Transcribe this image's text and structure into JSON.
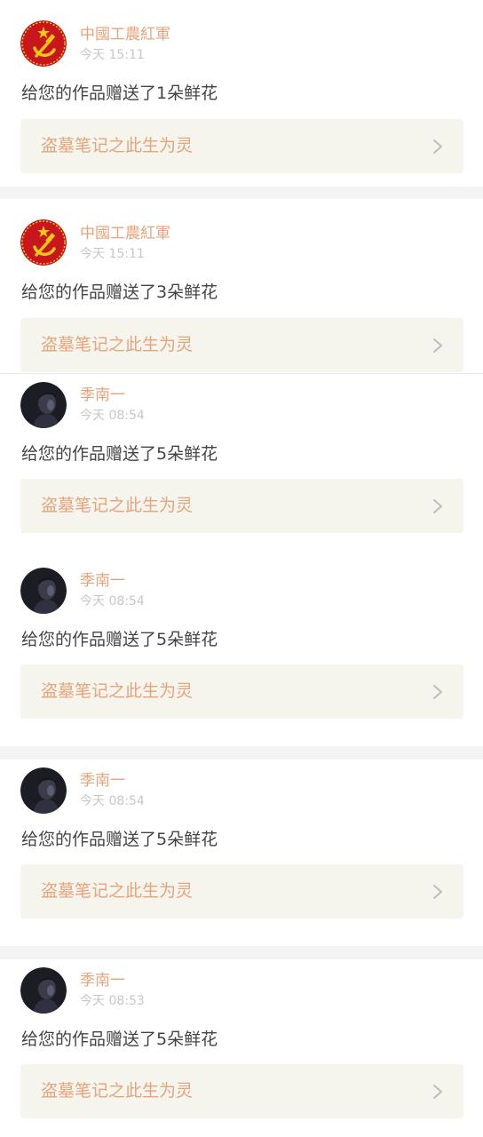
{
  "notifications": [
    {
      "username": "中國工農紅軍",
      "time": "今天 15:11",
      "message": "给您的作品赠送了1朵鲜花",
      "work_title": "盗墓笔记之此生为灵",
      "avatar_icon": "hammer-sickle-icon"
    },
    {
      "username": "中國工農紅軍",
      "time": "今天 15:11",
      "message": "给您的作品赠送了3朵鲜花",
      "work_title": "盗墓笔记之此生为灵",
      "avatar_icon": "hammer-sickle-icon"
    },
    {
      "username": "季南一",
      "time": "今天 08:54",
      "message": "给您的作品赠送了5朵鲜花",
      "work_title": "盗墓笔记之此生为灵",
      "avatar_icon": "portrait-icon"
    },
    {
      "username": "季南一",
      "time": "今天 08:54",
      "message": "给您的作品赠送了5朵鲜花",
      "work_title": "盗墓笔记之此生为灵",
      "avatar_icon": "portrait-icon"
    },
    {
      "username": "季南一",
      "time": "今天 08:54",
      "message": "给您的作品赠送了5朵鲜花",
      "work_title": "盗墓笔记之此生为灵",
      "avatar_icon": "portrait-icon"
    },
    {
      "username": "季南一",
      "time": "今天 08:53",
      "message": "给您的作品赠送了5朵鲜花",
      "work_title": "盗墓笔记之此生为灵",
      "avatar_icon": "portrait-icon"
    }
  ],
  "colors": {
    "accent": "#e8a37a",
    "muted": "#c7c7c7",
    "text": "#444444",
    "link_bg": "#f5f5ee",
    "separator": "#f4f4f4",
    "avatar_red": "#c8161d",
    "avatar_gold": "#f5c518"
  }
}
